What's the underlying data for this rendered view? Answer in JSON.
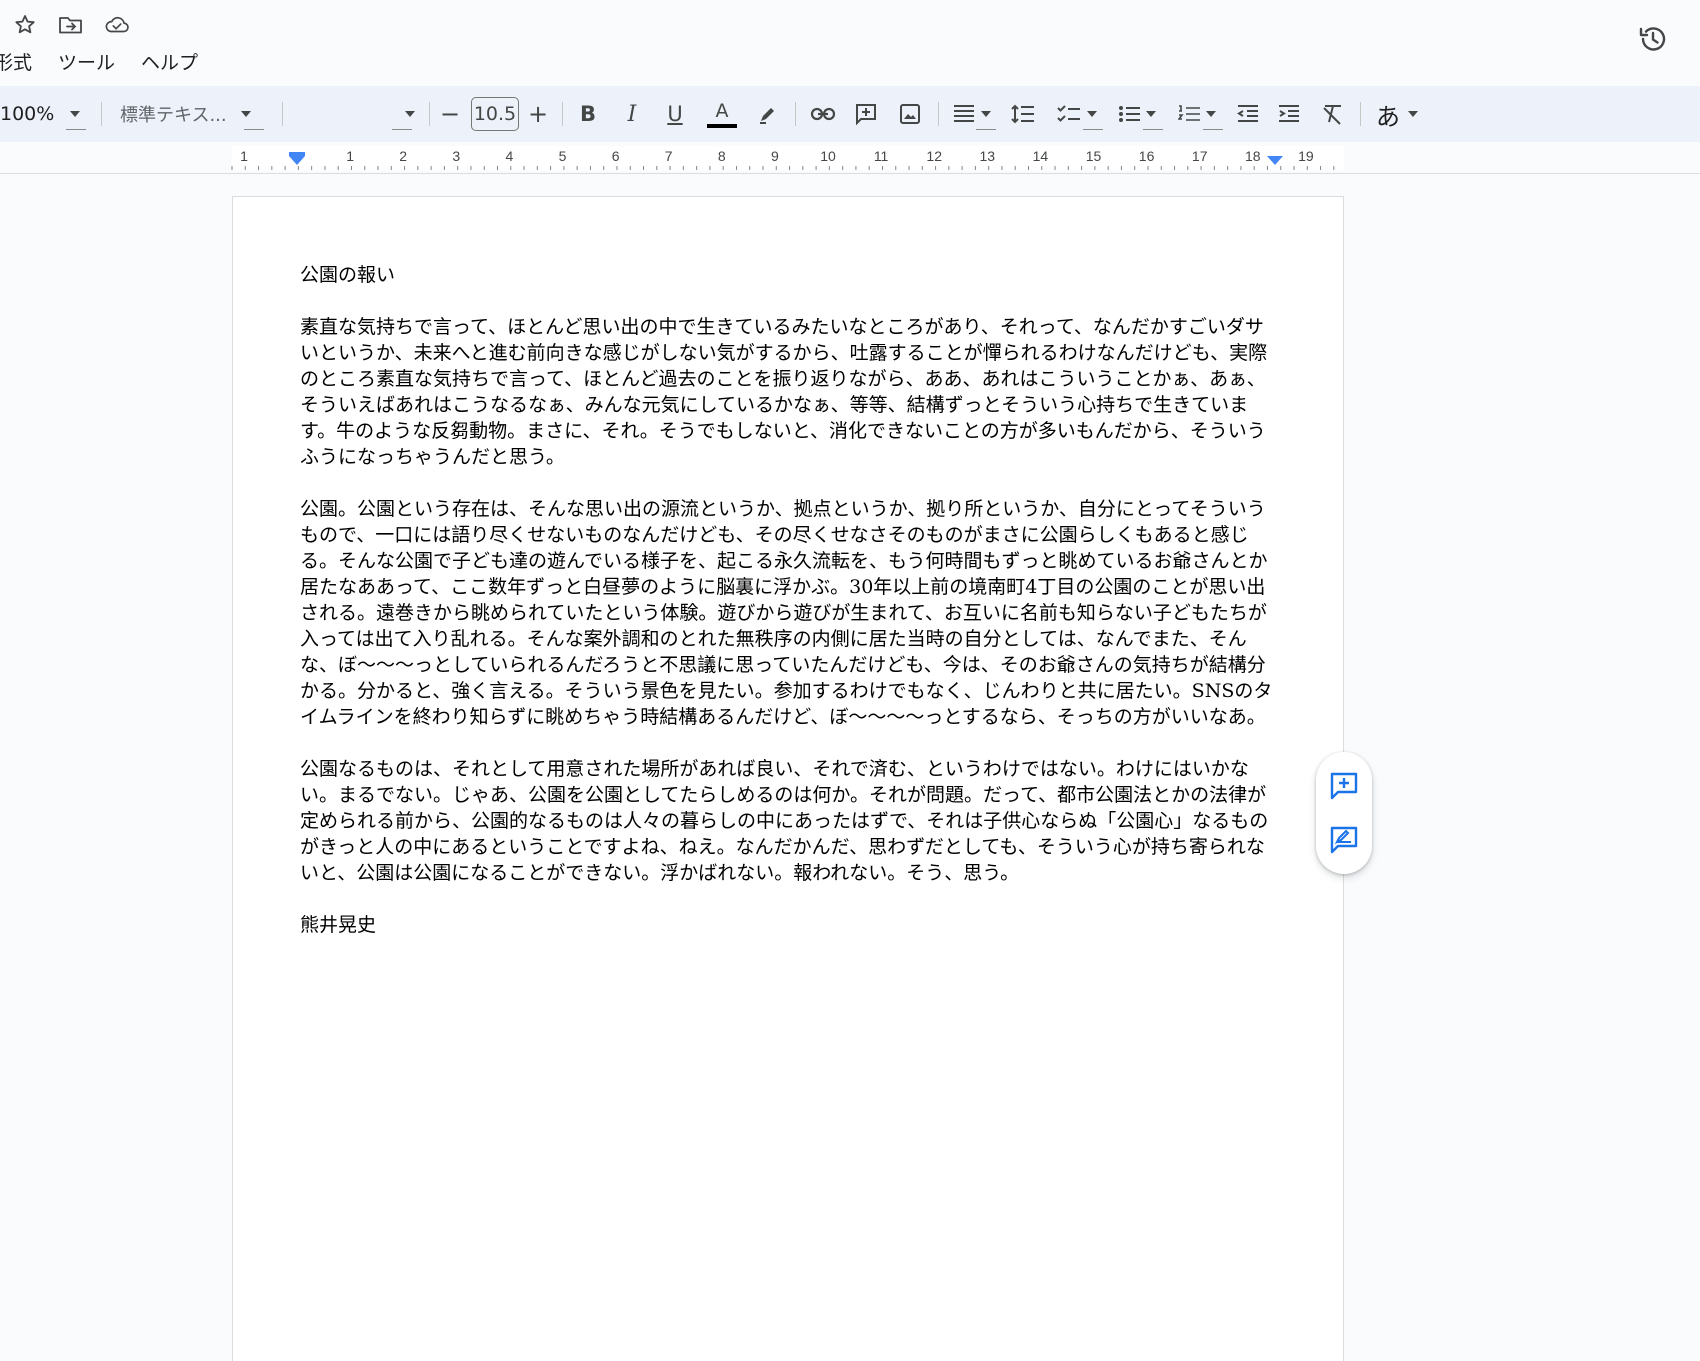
{
  "menu": {
    "items": [
      "形式",
      "ツール",
      "ヘルプ"
    ]
  },
  "toolbar": {
    "zoom": "100%",
    "style": "標準テキス...",
    "font_size": "10.5",
    "minus": "−",
    "plus": "+",
    "bold": "B",
    "italic": "I",
    "underline": "U",
    "text_color": "A",
    "input_tools": "あ"
  },
  "ruler": {
    "labels": [
      "1",
      "1",
      "2",
      "3",
      "4",
      "5",
      "6",
      "7",
      "8",
      "9",
      "10",
      "11",
      "12",
      "13",
      "14",
      "15",
      "16",
      "17",
      "18",
      "19"
    ]
  },
  "document": {
    "title": "公園の報い",
    "paragraphs": [
      "素直な気持ちで言って、ほとんど思い出の中で生きているみたいなところがあり、それって、なんだかすごいダサいというか、未来へと進む前向きな感じがしない気がするから、吐露することが憚られるわけなんだけども、実際のところ素直な気持ちで言って、ほとんど過去のことを振り返りながら、ああ、あれはこういうことかぁ、あぁ、そういえばあれはこうなるなぁ、みんな元気にしているかなぁ、等等、結構ずっとそういう心持ちで生きています。牛のような反芻動物。まさに、それ。そうでもしないと、消化できないことの方が多いもんだから、そういうふうになっちゃうんだと思う。",
      "公園。公園という存在は、そんな思い出の源流というか、拠点というか、拠り所というか、自分にとってそういうもので、一口には語り尽くせないものなんだけども、その尽くせなさそのものがまさに公園らしくもあると感じる。そんな公園で子ども達の遊んでいる様子を、起こる永久流転を、もう何時間もずっと眺めているお爺さんとか居たなああって、ここ数年ずっと白昼夢のように脳裏に浮かぶ。30年以上前の境南町4丁目の公園のことが思い出される。遠巻きから眺められていたという体験。遊びから遊びが生まれて、お互いに名前も知らない子どもたちが入っては出て入り乱れる。そんな案外調和のとれた無秩序の内側に居た当時の自分としては、なんでまた、そんな、ぼ〜〜〜っとしていられるんだろうと不思議に思っていたんだけども、今は、そのお爺さんの気持ちが結構分かる。分かると、強く言える。そういう景色を見たい。参加するわけでもなく、じんわりと共に居たい。SNSのタイムラインを終わり知らずに眺めちゃう時結構あるんだけど、ぼ〜〜〜〜っとするなら、そっちの方がいいなあ。",
      "公園なるものは、それとして用意された場所があれば良い、それで済む、というわけではない。わけにはいかない。まるでない。じゃあ、公園を公園としてたらしめるのは何か。それが問題。だって、都市公園法とかの法律が定められる前から、公園的なるものは人々の暮らしの中にあったはずで、それは子供心ならぬ「公園心」なるものがきっと人の中にあるということですよね、ねえ。なんだかんだ、思わずだとしても、そういう心が持ち寄られないと、公園は公園になることができない。浮かばれない。報われない。そう、思う。"
    ],
    "author": "熊井晃史"
  },
  "colors": {
    "accent": "#4285f4",
    "icon": "#444746",
    "toolbar_bg": "#edf2fa"
  }
}
